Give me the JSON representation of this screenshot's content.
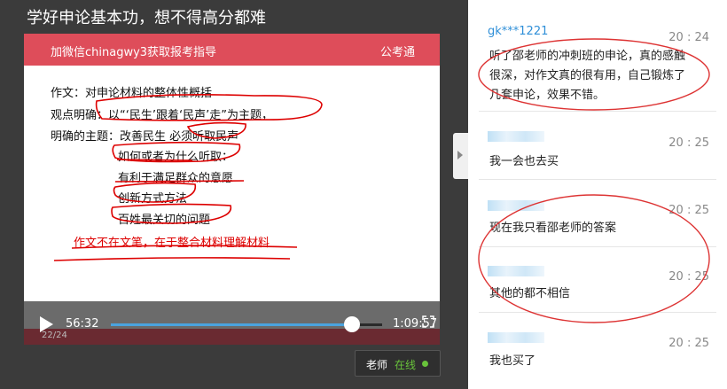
{
  "page_title": "学好申论基本功，想不得高分都难",
  "video": {
    "banner_left": "加微信chinagwy3获取报考指导",
    "banner_right": "公考通",
    "doc_lines": [
      "作文：对申论材料的整体性概括",
      "观点明确：以“‘民生’跟着‘民声’走”为主题，",
      "明确的主题：改善民生 必须听取民声",
      "如何或者为什么听取：",
      "有利于满足群众的意愿",
      "创新方式方法",
      "百姓最关切的问题",
      "作文不在文笔，在于整合材料理解材料"
    ],
    "current_time": "56:32",
    "total_time": "1:09:57",
    "progress": 0.89,
    "page_indicator": "22/24"
  },
  "teacher_badge": {
    "label": "老师",
    "status": "在线",
    "status_color": "#69c43b"
  },
  "chat": {
    "messages": [
      {
        "user": "gk***1221",
        "time": "20 : 24",
        "lines": [
          "听了邵老师的冲刺班的申论，真的感触",
          "很深，对作文真的很有用，自己锻炼了",
          "几套申论，效果不错。"
        ]
      },
      {
        "user": "",
        "time": "20 : 25",
        "lines": [
          "我一会也去买"
        ]
      },
      {
        "user": "",
        "time": "20 : 25",
        "lines": [
          "现在我只看邵老师的答案"
        ]
      },
      {
        "user": "",
        "time": "20 : 25",
        "lines": [
          "其他的都不相信"
        ]
      },
      {
        "user": "",
        "time": "20 : 25",
        "lines": [
          "我也买了"
        ]
      }
    ]
  },
  "colors": {
    "banner": "#de4d5a",
    "username": "#2f8fd8",
    "progress": "#4aa3df"
  }
}
